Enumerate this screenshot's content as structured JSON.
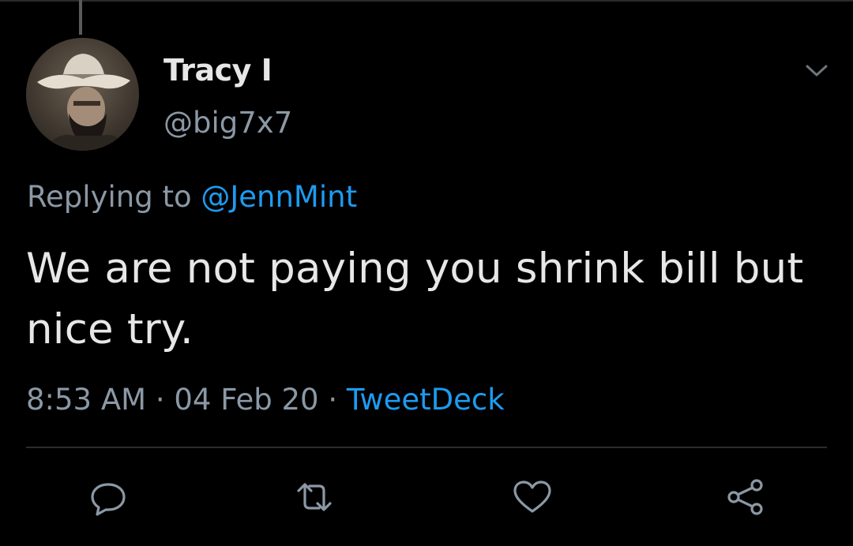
{
  "tweet": {
    "display_name": "Tracy I",
    "handle": "@big7x7",
    "replying_prefix": "Replying to ",
    "replying_to": "@JennMint",
    "text": "We are not paying you shrink bill but nice try.",
    "time": "8:53 AM",
    "separator": " · ",
    "date": "04 Feb 20",
    "source": "TweetDeck"
  },
  "icons": {
    "menu": "chevron-down-icon",
    "reply": "reply-icon",
    "retweet": "retweet-icon",
    "like": "heart-icon",
    "share": "share-icon"
  },
  "colors": {
    "background": "#000000",
    "text": "#e7e7e7",
    "secondary": "#8b98a5",
    "link": "#1d9bf0"
  }
}
